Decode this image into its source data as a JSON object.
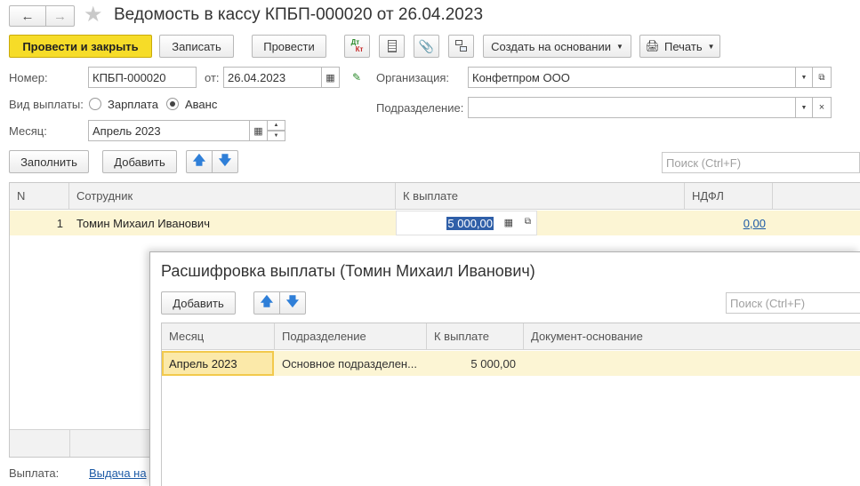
{
  "window": {
    "title": "Ведомость в кассу КПБП-000020 от 26.04.2023"
  },
  "toolbar": {
    "post_and_close": "Провести и закрыть",
    "save": "Записать",
    "post": "Провести",
    "dtkt_top": "Дт",
    "dtkt_bottom": "Кт",
    "create_based_on": "Создать на основании",
    "print": "Печать"
  },
  "form": {
    "number_label": "Номер:",
    "number_value": "КПБП-000020",
    "date_label": "от:",
    "date_value": "26.04.2023",
    "org_label": "Организация:",
    "org_value": "Конфетпром ООО",
    "payment_type_label": "Вид выплаты:",
    "payment_type_options": [
      "Зарплата",
      "Аванс"
    ],
    "payment_type_selected": "Аванс",
    "division_label": "Подразделение:",
    "division_value": "",
    "month_label": "Месяц:",
    "month_value": "Апрель 2023"
  },
  "table_toolbar": {
    "fill": "Заполнить",
    "add": "Добавить",
    "search_placeholder": "Поиск (Ctrl+F)"
  },
  "table": {
    "columns": [
      "N",
      "Сотрудник",
      "К выплате",
      "НДФЛ"
    ],
    "rows": [
      {
        "n": "1",
        "employee": "Томин Михаил Иванович",
        "amount": "5 000,00",
        "ndfl": "0,00"
      }
    ]
  },
  "footer": {
    "payment_label": "Выплата:",
    "payment_link": "Выдача на"
  },
  "popup": {
    "title": "Расшифровка выплаты (Томин Михаил Иванович)",
    "add": "Добавить",
    "search_placeholder": "Поиск (Ctrl+F)",
    "columns": [
      "Месяц",
      "Подразделение",
      "К выплате",
      "Документ-основание"
    ],
    "rows": [
      {
        "month": "Апрель 2023",
        "division": "Основное подразделен...",
        "amount": "5 000,00",
        "doc": ""
      }
    ]
  },
  "colors": {
    "primary_button": "#f6dc28",
    "selected_row": "#fcf5d4",
    "link": "#1c5aa6",
    "arrow_blue": "#2f7fd8"
  }
}
